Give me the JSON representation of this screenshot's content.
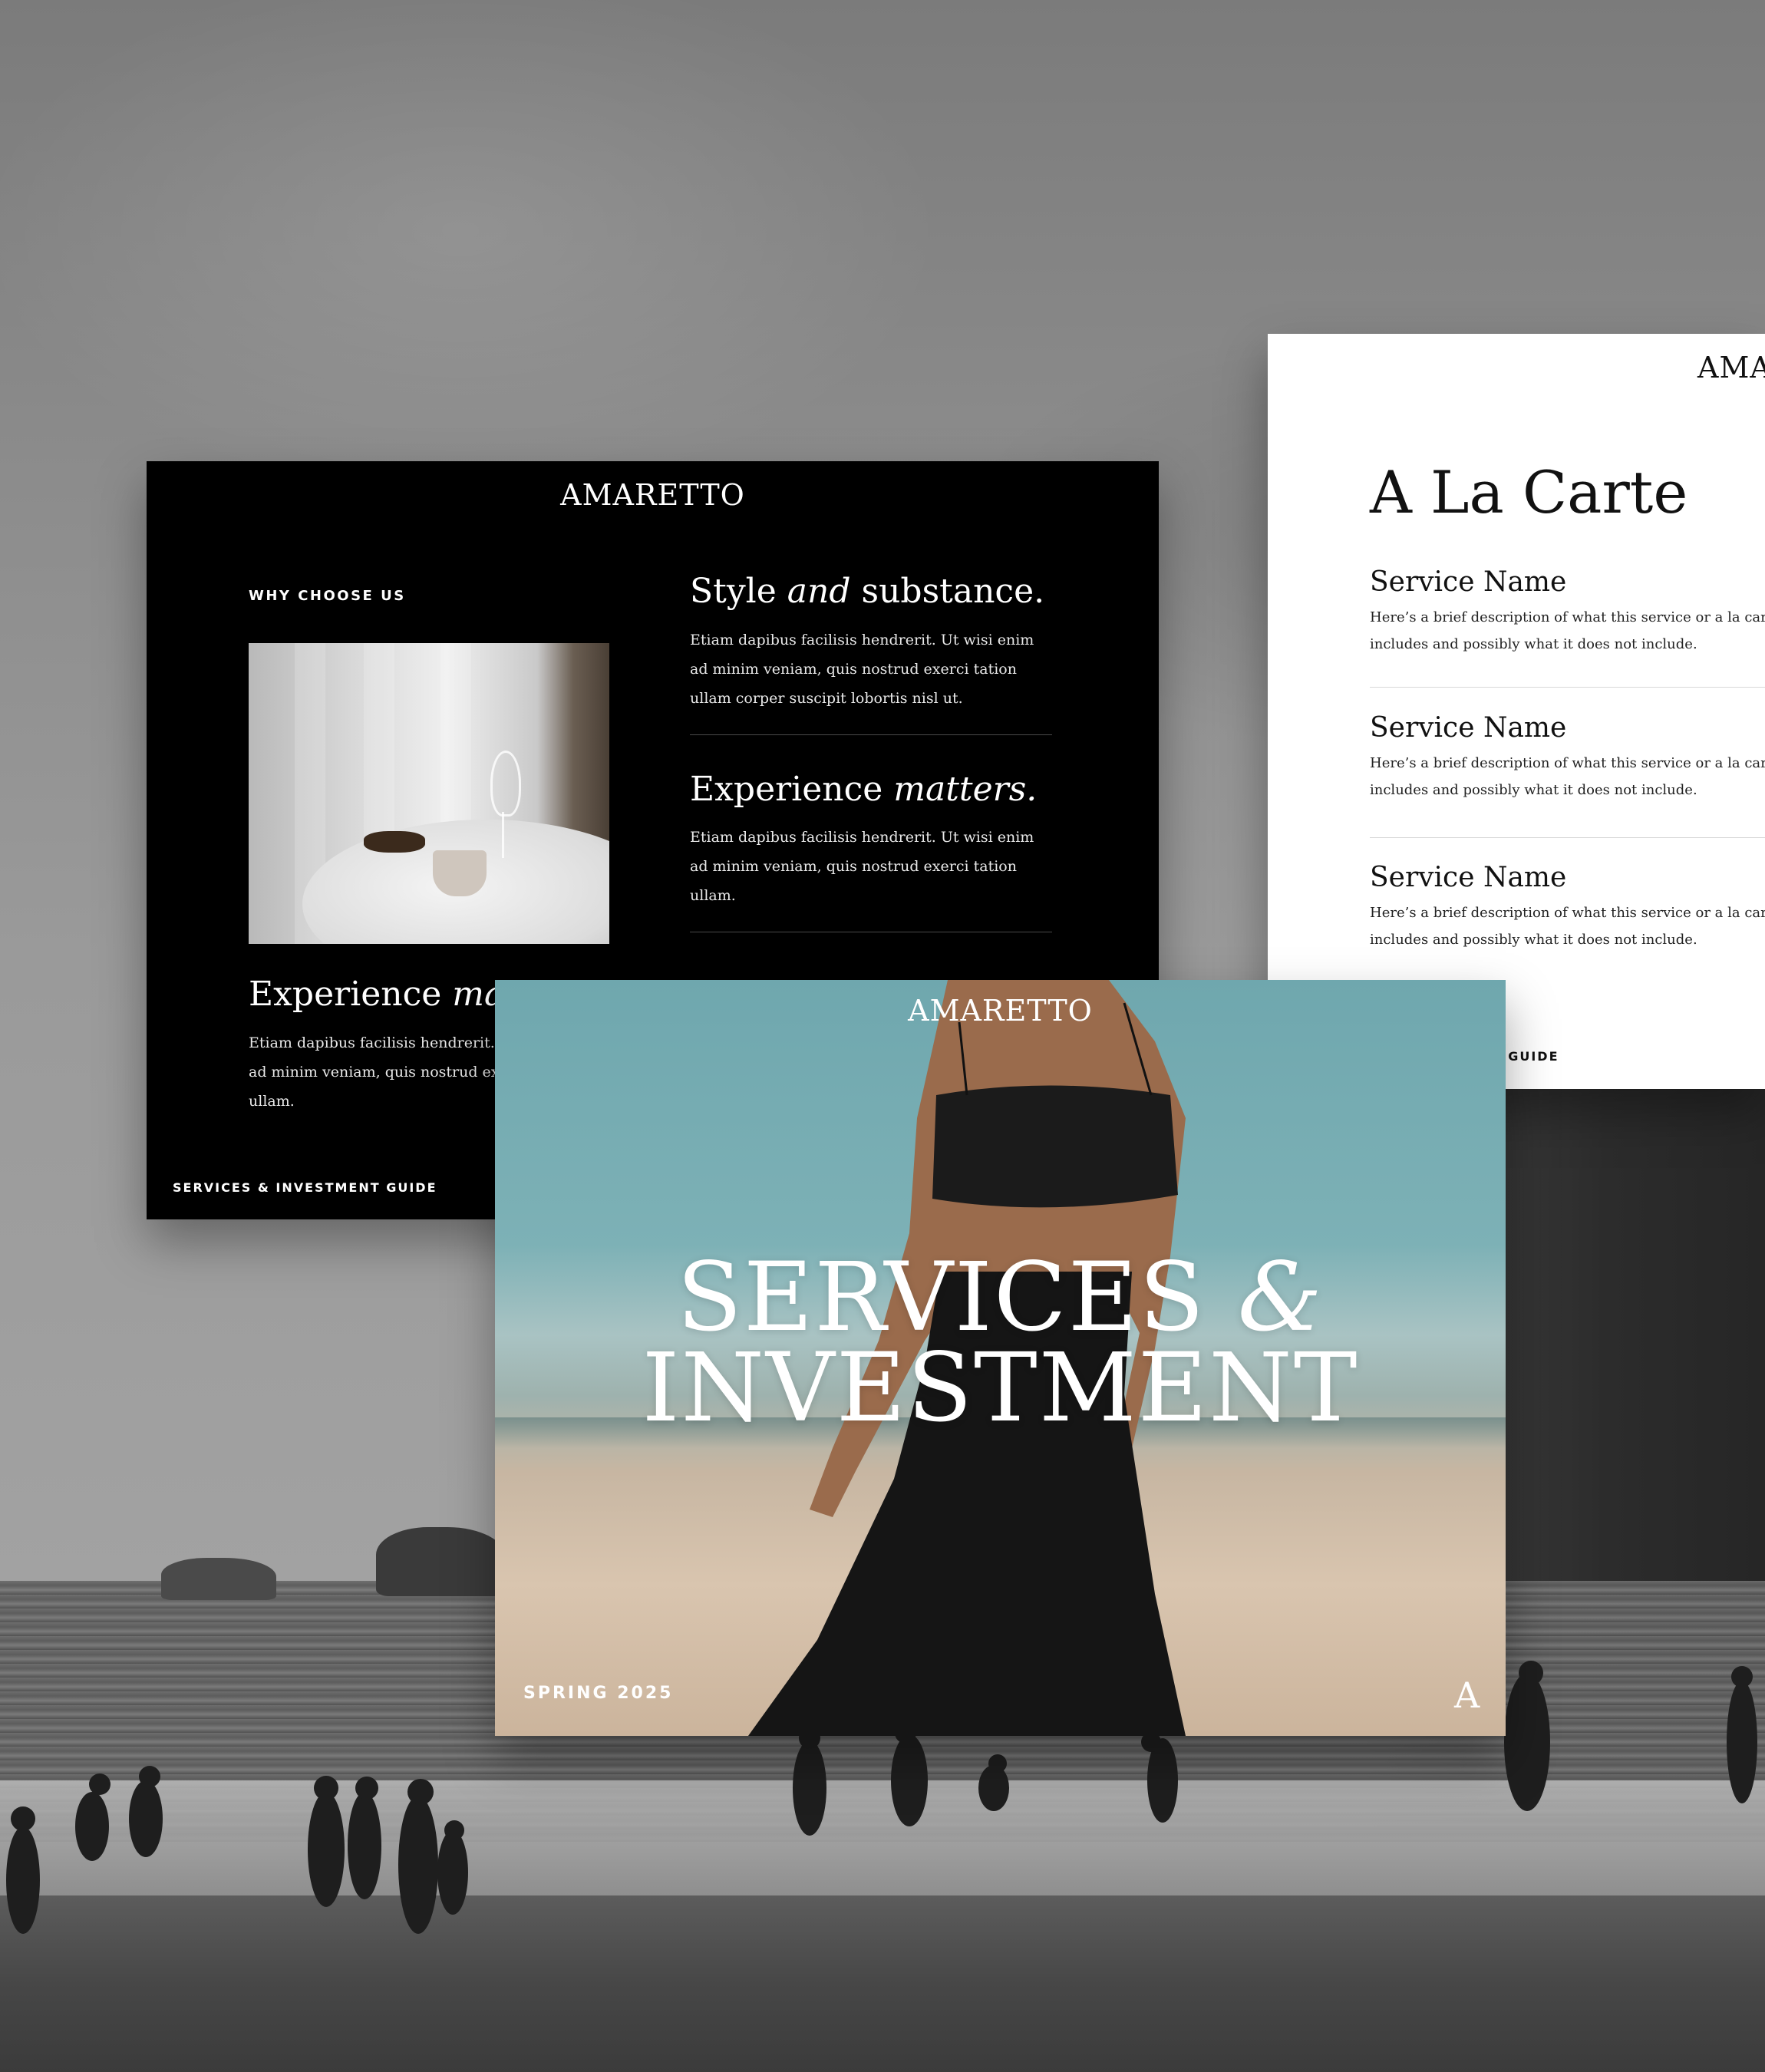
{
  "brand": "AMARETTO",
  "black_card": {
    "kicker": "WHY CHOOSE US",
    "block1": {
      "title_start": "Style ",
      "title_italic": "and",
      "title_end": " substance.",
      "body": "Etiam dapibus facilisis hendrerit. Ut wisi enim ad minim veniam, quis nostrud exerci tation ullam corper suscipit lobortis nisl ut."
    },
    "block2": {
      "title_start": "Experience ",
      "title_italic": "matters.",
      "body": "Etiam dapibus facilisis hendrerit. Ut wisi enim ad minim veniam, quis nostrud exerci tation ullam."
    },
    "block3": {
      "title_start": "Experience ",
      "title_italic": "matters.",
      "body": "Etiam dapibus facilisis hendrerit. Ut wisi enim ad minim veniam, quis nostrud exerci tation ullam."
    },
    "footer": "SERVICES & INVESTMENT GUIDE"
  },
  "white_card": {
    "brand": "AMARETTO",
    "title": "A La Carte",
    "services": [
      {
        "name": "Service Name",
        "line1": "Here’s a brief description of what this service or a la carte item",
        "line2": "includes and possibly what it does not include."
      },
      {
        "name": "Service Name",
        "line1": "Here’s a brief description of what this service or a la carte item",
        "line2": "includes and possibly what it does not include."
      },
      {
        "name": "Service Name",
        "line1": "Here’s a brief description of what this service or a la carte item",
        "line2": "includes and possibly what it does not include."
      }
    ],
    "footer": "SERVICES & INVESTMENT GUIDE"
  },
  "cover_card": {
    "title_line1": "SERVICES ",
    "title_amp": "&",
    "title_line2": "INVESTMENT",
    "season": "SPRING 2025",
    "monogram": "A"
  }
}
